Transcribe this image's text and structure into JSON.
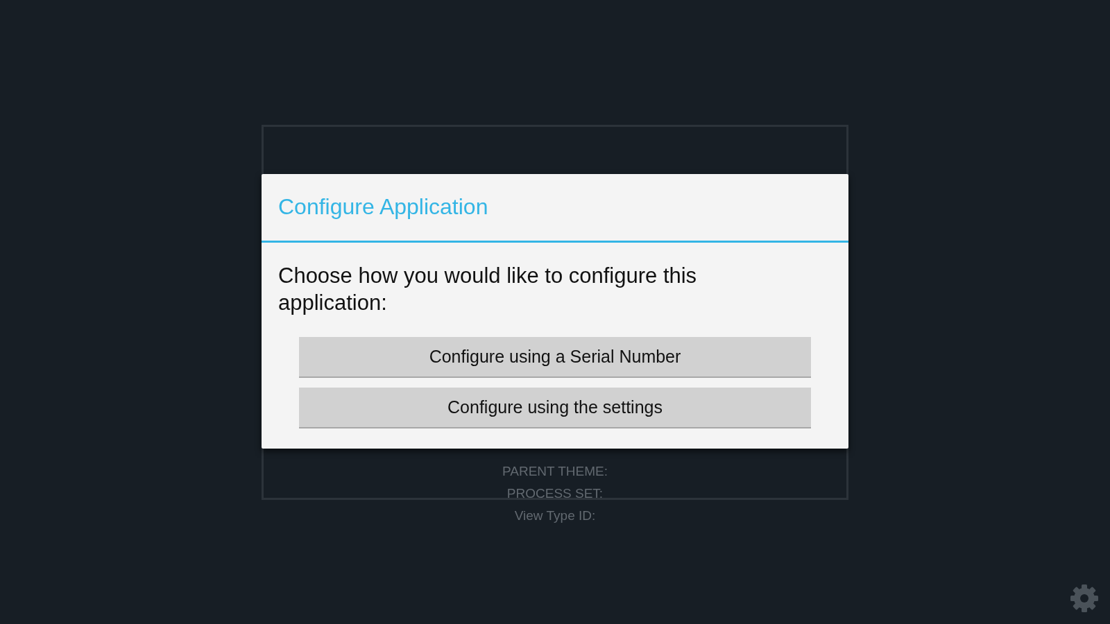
{
  "background_labels": [
    "PARENT THEME:",
    "PROCESS SET:",
    "View Type ID:"
  ],
  "dialog": {
    "title": "Configure Application",
    "message": "Choose how you would like to configure this application:",
    "buttons": [
      "Configure using a Serial Number",
      "Configure using the settings"
    ]
  }
}
